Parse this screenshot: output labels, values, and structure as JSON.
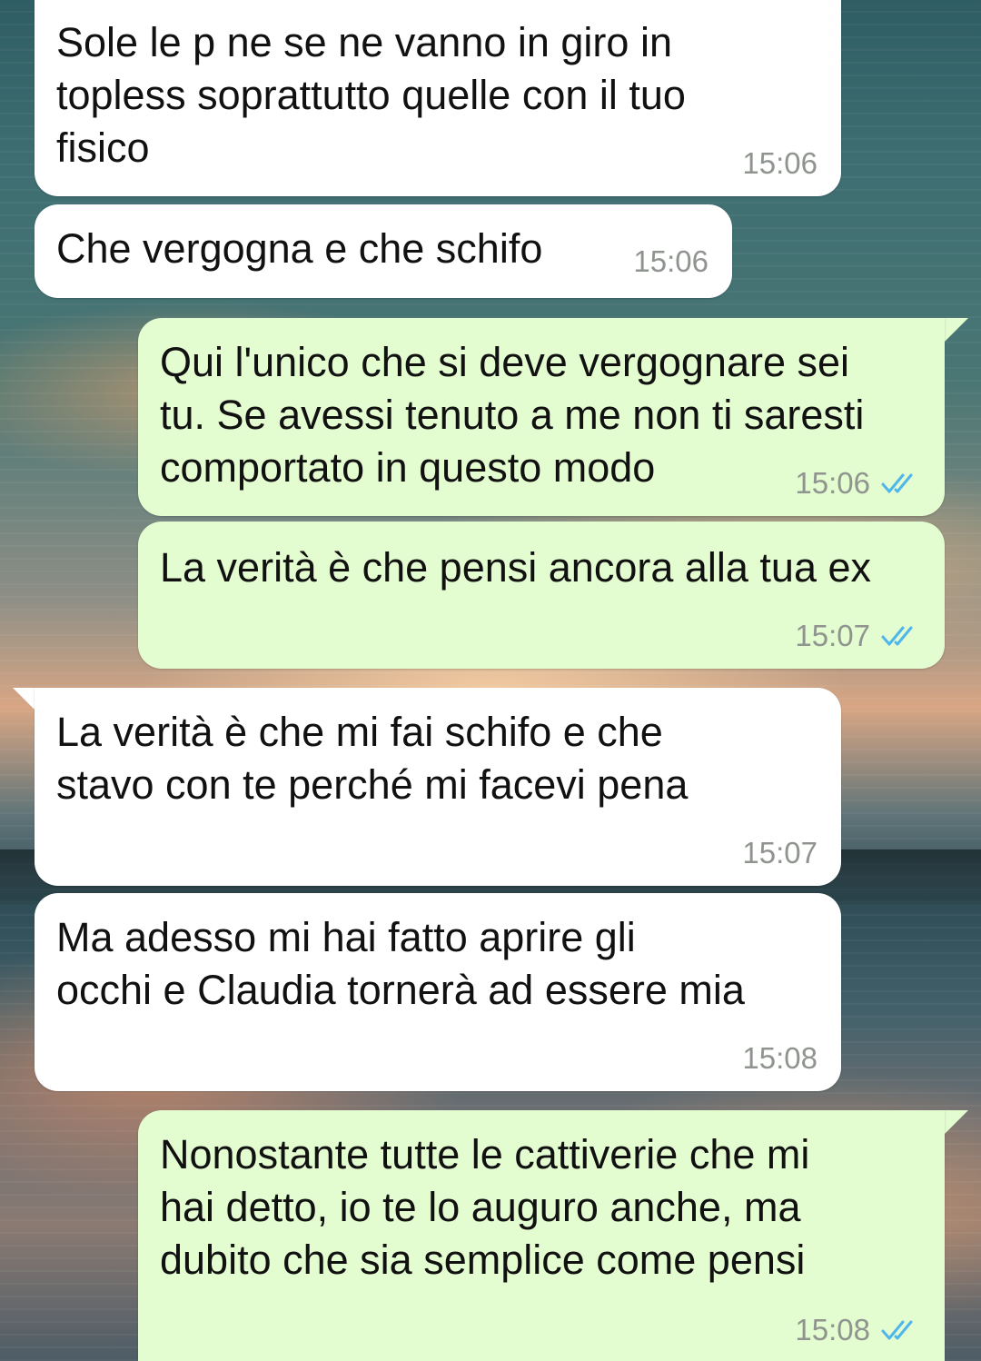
{
  "theme": {
    "incoming_bubble": "#ffffff",
    "outgoing_bubble": "#e3fcd0",
    "timestamp_color": "#8f948f",
    "read_ticks_color": "#4fb6ec"
  },
  "messages": [
    {
      "direction": "incoming",
      "text": "Sole le p      ne se ne vanno in giro in\ntopless soprattutto quelle con il tuo\nfisico",
      "time": "15:06"
    },
    {
      "direction": "incoming",
      "text": "Che vergogna e che schifo",
      "time": "15:06"
    },
    {
      "direction": "outgoing",
      "text": "Qui l'unico che si deve vergognare sei\ntu. Se avessi tenuto a me non ti saresti\ncomportato in questo modo",
      "time": "15:06",
      "status_icon": "double-check-read-icon"
    },
    {
      "direction": "outgoing",
      "text": "La verità è che pensi ancora alla tua ex",
      "time": "15:07",
      "status_icon": "double-check-read-icon"
    },
    {
      "direction": "incoming",
      "text": "La verità è che mi fai schifo e che\nstavo con te perché mi facevi pena",
      "time": "15:07"
    },
    {
      "direction": "incoming",
      "text": "Ma adesso mi hai fatto aprire gli\nocchi e Claudia tornerà ad essere mia",
      "time": "15:08"
    },
    {
      "direction": "outgoing",
      "text": "Nonostante tutte le cattiverie che mi\nhai detto, io te lo auguro anche, ma\ndubito che sia semplice come pensi",
      "time": "15:08",
      "status_icon": "double-check-read-icon"
    }
  ]
}
